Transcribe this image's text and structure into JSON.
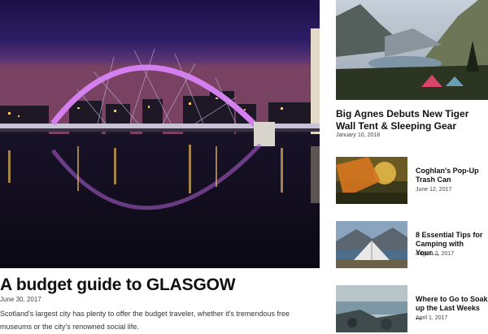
{
  "main_article": {
    "title": "A budget guide to GLASGOW",
    "date": "June 30, 2017",
    "excerpt": "Scotland's largest city has plenty to offer the budget traveler, whether it's tremendous free museums or the city's renowned social life."
  },
  "featured_article": {
    "title": "Big Agnes Debuts New Tiger Wall Tent & Sleeping Gear",
    "date": "January 10, 2018"
  },
  "sidebar_articles": [
    {
      "title": "Coghlan's Pop-Up Trash Can",
      "date": "June 12, 2017"
    },
    {
      "title": "8 Essential Tips for Camping with Your…",
      "date": "August 2, 2017"
    },
    {
      "title": "Where to Go to Soak up the Last Weeks …",
      "date": "April 1, 2017"
    }
  ],
  "colors": {
    "bridge_arch": "#c86be6",
    "night_sky": "#2b1a63"
  }
}
